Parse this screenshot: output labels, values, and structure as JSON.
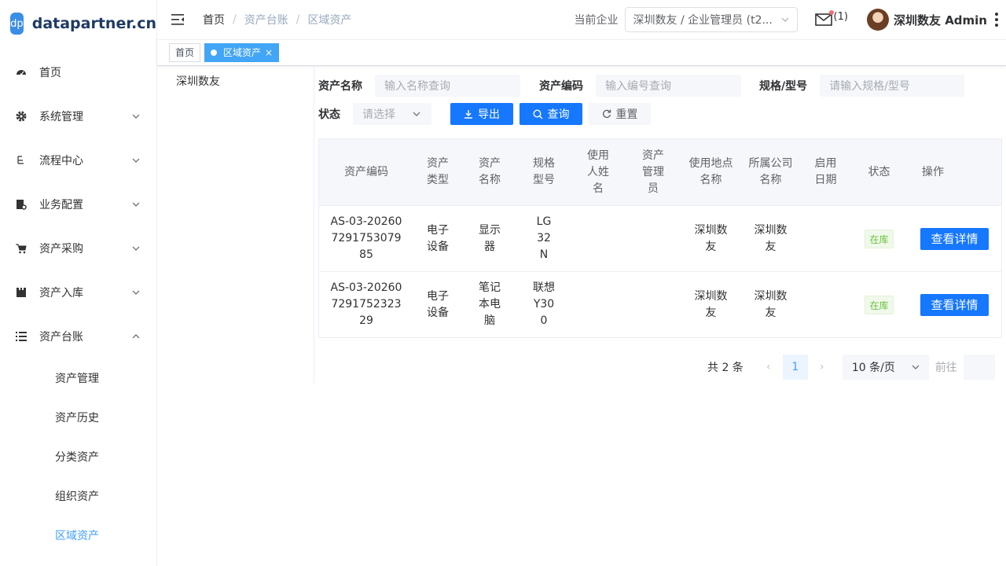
{
  "logo": {
    "badge": "dp",
    "text": "datapartner.cn"
  },
  "sidebar": {
    "items": [
      {
        "label": "首页",
        "icon": "dashboard-icon"
      },
      {
        "label": "系统管理",
        "icon": "gear-icon",
        "expandable": true
      },
      {
        "label": "流程中心",
        "icon": "flow-icon",
        "expandable": true
      },
      {
        "label": "业务配置",
        "icon": "config-icon",
        "expandable": true
      },
      {
        "label": "资产采购",
        "icon": "cart-icon",
        "expandable": true
      },
      {
        "label": "资产入库",
        "icon": "warehouse-icon",
        "expandable": true
      },
      {
        "label": "资产台账",
        "icon": "list-icon",
        "expandable": true,
        "expanded": true
      }
    ],
    "subitems": [
      "资产管理",
      "资产历史",
      "分类资产",
      "组织资产",
      "区域资产"
    ],
    "active_subitem": "区域资产"
  },
  "header": {
    "breadcrumb": [
      "首页",
      "资产台账",
      "区域资产"
    ],
    "company_label": "当前企业",
    "company_value": "深圳数友 / 企业管理员 (t2...",
    "mail_count": "(1)",
    "user_name": "深圳数友 Admin"
  },
  "tags": {
    "home": "首页",
    "active": "区域资产",
    "close": "×"
  },
  "tree": {
    "root": "深圳数友"
  },
  "filters": {
    "name_label": "资产名称",
    "name_placeholder": "输入名称查询",
    "code_label": "资产编码",
    "code_placeholder": "输入编号查询",
    "spec_label": "规格/型号",
    "spec_placeholder": "请输入规格/型号",
    "status_label": "状态",
    "status_placeholder": "请选择",
    "export": "导出",
    "search": "查询",
    "reset": "重置"
  },
  "table": {
    "headers": [
      "资产编码",
      "资产类型",
      "资产名称",
      "规格型号",
      "使用人姓名",
      "资产管理员",
      "使用地点名称",
      "所属公司名称",
      "启用日期",
      "状态",
      "操作"
    ],
    "rows": [
      {
        "code": "AS-03-20260729175307985",
        "type": "电子设备",
        "name": "显示器",
        "spec": "LG 32N",
        "user": "",
        "admin": "",
        "location": "深圳数友",
        "company": "深圳数友",
        "date": "",
        "status": "在库",
        "action": "查看详情"
      },
      {
        "code": "AS-03-20260729175232329",
        "type": "电子设备",
        "name": "笔记本电脑",
        "spec": "联想Y300",
        "user": "",
        "admin": "",
        "location": "深圳数友",
        "company": "深圳数友",
        "date": "",
        "status": "在库",
        "action": "查看详情"
      }
    ]
  },
  "pagination": {
    "total": "共 2 条",
    "page": "1",
    "size": "10 条/页",
    "goto": "前往"
  },
  "colors": {
    "primary": "#1677ff",
    "accent": "#409eff",
    "success": "#67c23a"
  }
}
